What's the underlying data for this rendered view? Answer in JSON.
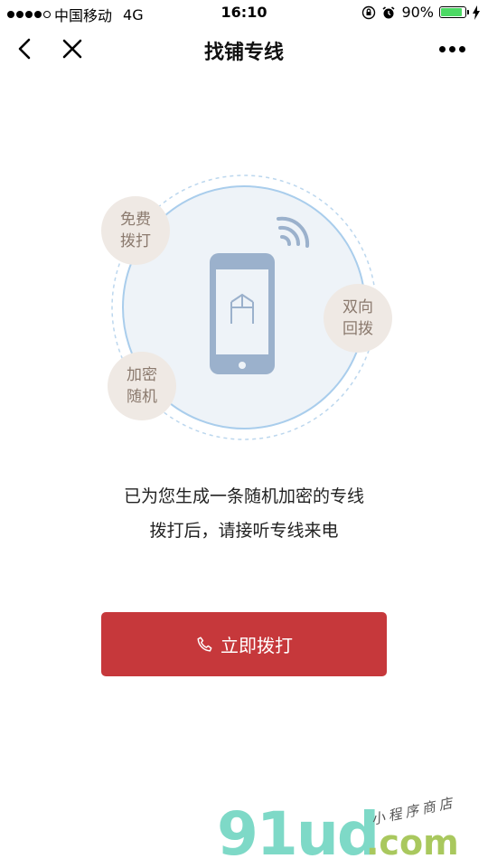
{
  "status_bar": {
    "carrier": "中国移动",
    "network": "4G",
    "time": "16:10",
    "battery": "90%",
    "battery_level": 0.9
  },
  "nav": {
    "title": "找铺专线"
  },
  "badges": {
    "free": {
      "line1": "免费",
      "line2": "拨打"
    },
    "callback": {
      "line1": "双向",
      "line2": "回拨"
    },
    "encrypt": {
      "line1": "加密",
      "line2": "随机"
    }
  },
  "message": {
    "line1": "已为您生成一条随机加密的专线",
    "line2": "拨打后，请接听专线来电"
  },
  "call_button": {
    "label": "立即拨打",
    "icon": "phone-icon"
  },
  "watermark": {
    "brand": "91ud",
    "domain": ".com",
    "tagline": "小程序商店"
  },
  "colors": {
    "accent": "#c6383b",
    "badge_bg": "#efe9e4",
    "badge_text": "#8b7a6e",
    "circle_fill": "#eef3f8",
    "phone": "#9bb1cc"
  }
}
